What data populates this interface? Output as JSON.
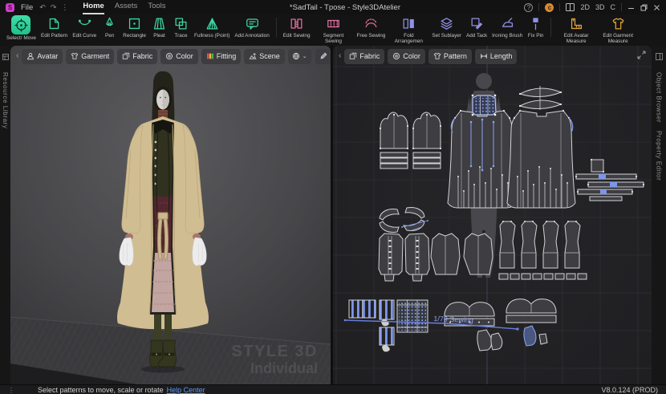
{
  "titlebar": {
    "title": "*SadTail - Tpose - Style3DAtelier",
    "file_menu": "File",
    "doc_tabs": [
      {
        "label": "Home",
        "active": true
      },
      {
        "label": "Assets",
        "active": false
      },
      {
        "label": "Tools",
        "active": false
      }
    ],
    "view_2d": "2D",
    "view_3d": "3D",
    "reset_view": "C"
  },
  "toolbar": {
    "groups": [
      {
        "color": "#3fd6a0",
        "sep_before": false,
        "items": [
          {
            "label": "Select/ Move",
            "icon": "select-move",
            "active": true
          },
          {
            "label": "Edit Pattern",
            "icon": "edit-pattern"
          },
          {
            "label": "Edit Curve",
            "icon": "edit-curve"
          },
          {
            "label": "Pen",
            "icon": "pen"
          },
          {
            "label": "Rectangle",
            "icon": "rectangle"
          },
          {
            "label": "Pleat",
            "icon": "pleat"
          },
          {
            "label": "Trace",
            "icon": "trace"
          },
          {
            "label": "Fullness (Point)",
            "icon": "fullness-point"
          },
          {
            "label": "Add Annotation",
            "icon": "add-annotation"
          }
        ]
      },
      {
        "color": "#e0709f",
        "sep_before": true,
        "items": [
          {
            "label": "Edit Sewing",
            "icon": "edit-sewing"
          },
          {
            "label": "Segment Sewing",
            "icon": "segment-sewing"
          },
          {
            "label": "Free Sewing",
            "icon": "free-sewing"
          }
        ]
      },
      {
        "color": "#9090e8",
        "sep_before": false,
        "items": [
          {
            "label": "Fold Arrangemen",
            "icon": "fold-arrangement"
          },
          {
            "label": "Set Sublayer",
            "icon": "set-sublayer"
          },
          {
            "label": "Add Tack",
            "icon": "add-tack"
          },
          {
            "label": "Ironing Brush",
            "icon": "ironing-brush"
          },
          {
            "label": "Fix Pin",
            "icon": "fix-pin"
          }
        ]
      },
      {
        "color": "#dfa23f",
        "sep_before": true,
        "items": [
          {
            "label": "Edit Avatar Measure",
            "icon": "edit-avatar-measure"
          },
          {
            "label": "Edit Garment Measure",
            "icon": "edit-garment-measure"
          }
        ]
      }
    ]
  },
  "left_strip": {
    "label": "Resource Library"
  },
  "right_strip": {
    "top_label": "Object Browser",
    "bottom_label": "Property Editor"
  },
  "viewport3d": {
    "tabs": [
      "Avatar",
      "Garment",
      "Fabric",
      "Color",
      "Fitting",
      "Scene"
    ],
    "watermark": [
      "STYLE 3D",
      "Individual"
    ]
  },
  "viewport2d": {
    "tabs": [
      "Fabric",
      "Color",
      "Pattern",
      "Length"
    ],
    "annotation": "1/79 Sewing"
  },
  "statusbar": {
    "message": "Select patterns to move, scale or rotate",
    "link": "Help Center",
    "version": "V8.0.124 (PROD)"
  },
  "colors": {
    "tool_green": "#3fd6a0",
    "tool_pink": "#e0709f",
    "tool_purple": "#9090e8",
    "tool_orange": "#dfa23f",
    "selection_blue": "#7d96ea",
    "coat_tan": "#d1bd92"
  }
}
